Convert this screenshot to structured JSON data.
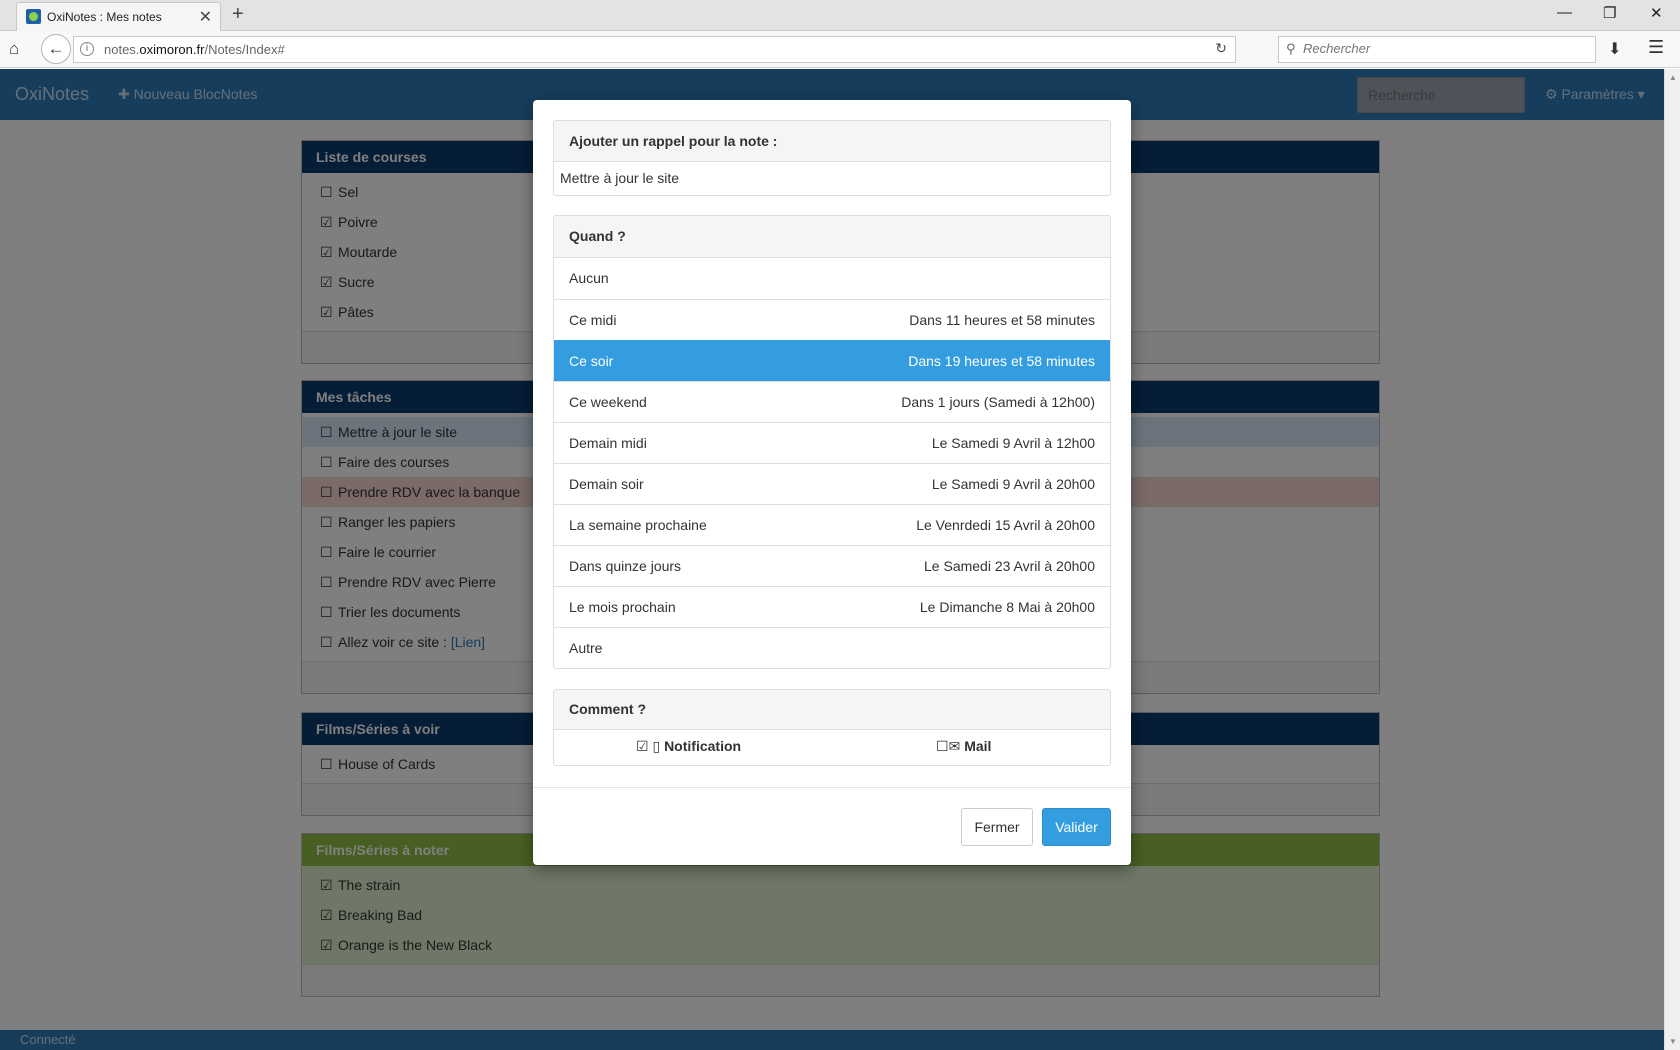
{
  "browser": {
    "tab_title": "OxiNotes : Mes notes",
    "tab_close": "✕",
    "new_tab": "+",
    "url_prefix": "notes.",
    "url_domain": "oximoron.fr",
    "url_path": "/Notes/Index#",
    "search_placeholder": "Rechercher",
    "window_controls": [
      "—",
      "❐",
      "✕"
    ]
  },
  "app": {
    "brand": "OxiNotes",
    "new_notebook": "Nouveau BlocNotes",
    "search_placeholder": "Recherche",
    "settings": "Paramètres",
    "status": "Connecté"
  },
  "panels": [
    {
      "title": "Liste de courses",
      "items": [
        {
          "label": "Sel",
          "checked": false
        },
        {
          "label": "Poivre",
          "checked": true
        },
        {
          "label": "Moutarde",
          "checked": true
        },
        {
          "label": "Sucre",
          "checked": true
        },
        {
          "label": "Pâtes",
          "checked": true
        }
      ]
    },
    {
      "title": "Mes tâches",
      "items": [
        {
          "label": "Mettre à jour le site",
          "checked": false
        },
        {
          "label": "Faire des courses",
          "checked": false
        },
        {
          "label": "Prendre RDV avec la banque",
          "checked": false
        },
        {
          "label": "Ranger les papiers",
          "checked": false
        },
        {
          "label": "Faire le courrier",
          "checked": false
        },
        {
          "label": "Prendre RDV avec Pierre",
          "checked": false
        },
        {
          "label": "Trier les documents",
          "checked": false
        },
        {
          "label": "Allez voir ce site :",
          "link": "[Lien]",
          "checked": false
        }
      ]
    },
    {
      "title": "Films/Séries à voir",
      "items": [
        {
          "label": "House of Cards",
          "checked": false
        }
      ]
    },
    {
      "title": "Films/Séries à noter",
      "items": [
        {
          "label": "The strain",
          "checked": true
        },
        {
          "label": "Breaking Bad",
          "checked": true
        },
        {
          "label": "Orange is the New Black",
          "checked": true
        }
      ]
    }
  ],
  "modal": {
    "reminder_title": "Ajouter un rappel pour la note :",
    "note_name": "Mettre à jour le site",
    "when_title": "Quand ?",
    "when_options": [
      {
        "label": "Aucun",
        "detail": ""
      },
      {
        "label": "Ce midi",
        "detail": "Dans 11 heures et 58 minutes"
      },
      {
        "label": "Ce soir",
        "detail": "Dans 19 heures et 58 minutes",
        "active": true
      },
      {
        "label": "Ce weekend",
        "detail": "Dans 1 jours (Samedi à 12h00)"
      },
      {
        "label": "Demain midi",
        "detail": "Le Samedi 9 Avril à 12h00"
      },
      {
        "label": "Demain soir",
        "detail": "Le Samedi 9 Avril à 20h00"
      },
      {
        "label": "La semaine prochaine",
        "detail": "Le Venrdedi 15 Avril à 20h00"
      },
      {
        "label": "Dans quinze jours",
        "detail": "Le Samedi 23 Avril à 20h00"
      },
      {
        "label": "Le mois prochain",
        "detail": "Le Dimanche 8 Mai à 20h00"
      },
      {
        "label": "Autre",
        "detail": ""
      }
    ],
    "how_title": "Comment ?",
    "notification_label": "Notification",
    "notification_checked": true,
    "mail_label": "Mail",
    "mail_checked": false,
    "close_button": "Fermer",
    "validate_button": "Valider"
  },
  "colors": {
    "navbar": "#2c7bb8",
    "panel_heading": "#0a3b6c",
    "panel_heading_green": "#8fbe44",
    "active_item": "#339de0"
  }
}
